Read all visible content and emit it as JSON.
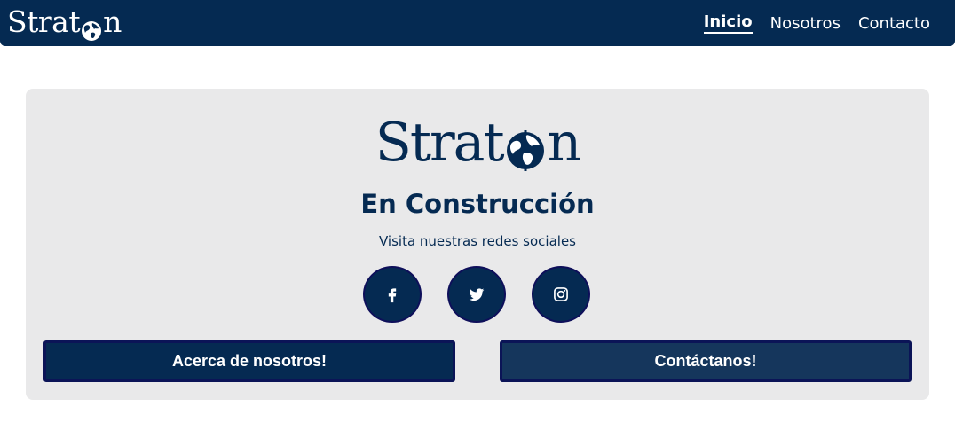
{
  "navbar": {
    "brand_prefix": "Strat",
    "brand_suffix": "n",
    "links": [
      {
        "label": "Inicio",
        "active": true
      },
      {
        "label": "Nosotros",
        "active": false
      },
      {
        "label": "Contacto",
        "active": false
      }
    ]
  },
  "hero": {
    "logo_prefix": "Strat",
    "logo_suffix": "n",
    "heading": "En Construcción",
    "subtitle": "Visita nuestras redes sociales",
    "socials": [
      {
        "icon": "facebook-icon"
      },
      {
        "icon": "twitter-icon"
      },
      {
        "icon": "instagram-icon"
      }
    ]
  },
  "actions": {
    "about_label": "Acerca de nosotros!",
    "contact_label": "Contáctanos!"
  },
  "colors": {
    "navy": "#052a52",
    "card_bg": "#e9e9ea",
    "button_border": "#0b1457"
  }
}
